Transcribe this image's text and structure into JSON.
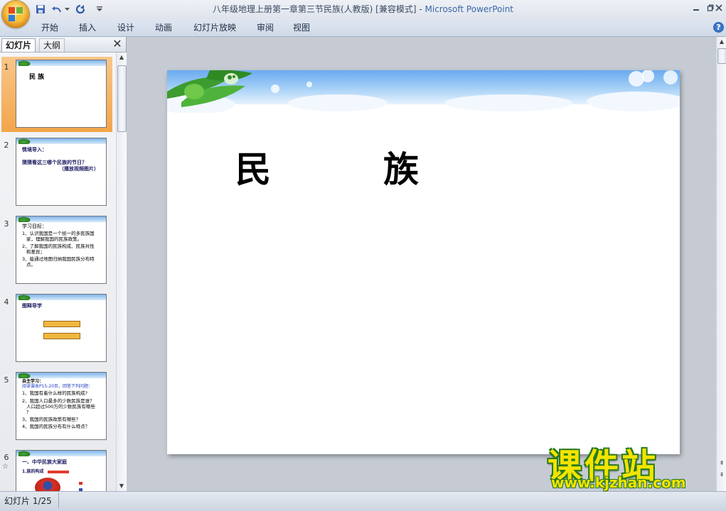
{
  "window": {
    "title": "八年级地理上册第一章第三节民族(人教版) [兼容模式] - ",
    "app_name": "Microsoft PowerPoint"
  },
  "ribbon": {
    "tabs": [
      "开始",
      "插入",
      "设计",
      "动画",
      "幻灯片放映",
      "审阅",
      "视图"
    ]
  },
  "panel": {
    "tab_slides": "幻灯片",
    "tab_outline": "大纲",
    "close_symbol": "✕"
  },
  "thumbnails": [
    {
      "num": "1",
      "lines": [
        "民     族"
      ]
    },
    {
      "num": "2",
      "lines": [
        "情境导入：",
        "猜猜看这三哪个民族的节日？",
        "（播放视频图片）"
      ]
    },
    {
      "num": "3",
      "lines": [
        "学习目标：",
        "1、认识我国是一个统一的多民族国",
        "家，理解我国的民族政策。",
        "2、了解我国的民族构成、民族共性",
        "和差异；",
        "3、能通过地图归纳我国民族分布特",
        "点。"
      ]
    },
    {
      "num": "4",
      "lines": [
        "图释导学"
      ]
    },
    {
      "num": "5",
      "lines": [
        "自主学习：",
        "阅读课本P15-20页，回答下列问题：",
        "1、我国有着什么样的民族构成?",
        "2、我国人口最多的少数民族是谁？",
        "人口超过500万的少数民族有哪些",
        "？",
        "3、我国的民族政策有哪些？",
        "4、我国的民族分布有什么特点？"
      ]
    },
    {
      "num": "6",
      "lines": [
        "一、中华民族大家庭",
        "1.族的构成"
      ]
    }
  ],
  "slide": {
    "title": "民　　　族"
  },
  "status": {
    "slide_indicator": "幻灯片 1/25"
  },
  "watermark": {
    "title": "课件站",
    "url": "www.kjzhan.com"
  },
  "colors": {
    "title_app": "#3b68a8",
    "selected_thumb": "#f2a54a",
    "watermark_fill": "#f2e400",
    "watermark_outline": "#2a7a20"
  }
}
